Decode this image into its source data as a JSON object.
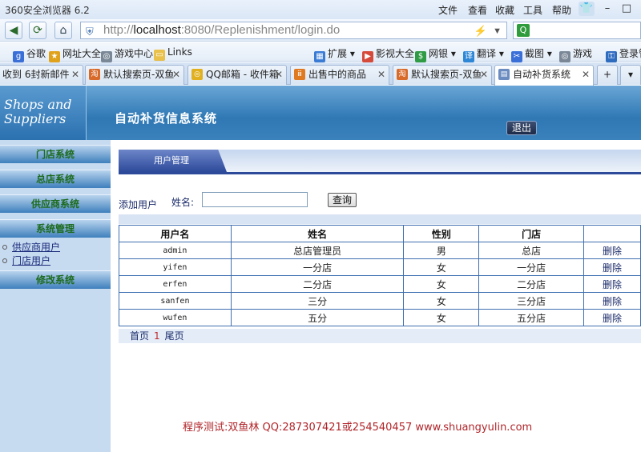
{
  "browser": {
    "title": "360安全浏览器 6.2",
    "menu": [
      "文件",
      "查看",
      "收藏",
      "工具",
      "帮助"
    ],
    "url_prefix": "http://",
    "url_host": "localhost",
    "url_rest": ":8080/Replenishment/login.do",
    "favorites": [
      {
        "label": "谷歌",
        "icon": "google-icon"
      },
      {
        "label": "网址大全",
        "icon": "directory-icon"
      },
      {
        "label": "游戏中心",
        "icon": "gamepad-icon"
      },
      {
        "label": "Links",
        "icon": "folder-icon"
      },
      {
        "label": "扩展",
        "icon": "extension-icon"
      },
      {
        "label": "影视大全",
        "icon": "video-icon"
      },
      {
        "label": "网银",
        "icon": "bank-icon"
      },
      {
        "label": "翻译",
        "icon": "translate-icon"
      },
      {
        "label": "截图",
        "icon": "screenshot-icon"
      },
      {
        "label": "游戏",
        "icon": "game-icon"
      },
      {
        "label": "登录管",
        "icon": "login-icon"
      }
    ],
    "tabs": [
      {
        "label": "收到 6封新邮件",
        "active": false
      },
      {
        "label": "默认搜索页-双鱼",
        "active": false
      },
      {
        "label": "QQ邮箱 - 收件箱",
        "active": false
      },
      {
        "label": "出售中的商品",
        "active": false
      },
      {
        "label": "默认搜索页-双鱼",
        "active": false
      },
      {
        "label": "自动补货系统",
        "active": true
      }
    ]
  },
  "app": {
    "logo_line1": "Shops and",
    "logo_line2": "Suppliers",
    "system_title": "自动补货信息系统",
    "logout_label": "退出"
  },
  "sidebar": {
    "sections": [
      "门店系统",
      "总店系统",
      "供应商系统",
      "系统管理",
      "修改系统"
    ],
    "sublinks": [
      "供应商用户",
      "门店用户"
    ]
  },
  "panel": {
    "tab_label": "用户管理",
    "add_user_label": "添加用户",
    "name_label": "姓名:",
    "name_value": "",
    "query_label": "查询"
  },
  "table": {
    "headers": [
      "用户名",
      "姓名",
      "性别",
      "门店",
      ""
    ],
    "rows": [
      {
        "username": "admin",
        "name": "总店管理员",
        "gender": "男",
        "store": "总店",
        "action": "删除"
      },
      {
        "username": "yifen",
        "name": "一分店",
        "gender": "女",
        "store": "一分店",
        "action": "删除"
      },
      {
        "username": "erfen",
        "name": "二分店",
        "gender": "女",
        "store": "二分店",
        "action": "删除"
      },
      {
        "username": "sanfen",
        "name": "三分",
        "gender": "女",
        "store": "三分店",
        "action": "删除"
      },
      {
        "username": "wufen",
        "name": "五分",
        "gender": "女",
        "store": "五分店",
        "action": "删除"
      }
    ]
  },
  "pager": {
    "first": "首页",
    "current": "1",
    "last": "尾页"
  },
  "footer_note": "程序测试:双鱼林 QQ:287307421或254540457 www.shuangyulin.com"
}
